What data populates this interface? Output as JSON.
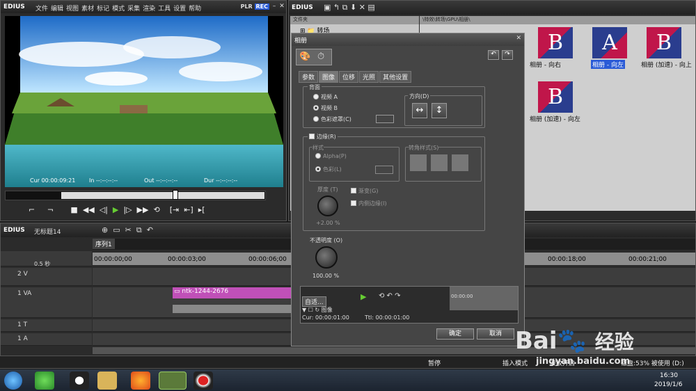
{
  "player": {
    "logo": "EDIUS",
    "menu": [
      "文件",
      "编辑",
      "视图",
      "素材",
      "标记",
      "模式",
      "采集",
      "渲染",
      "工具",
      "设置",
      "帮助"
    ],
    "plr": "PLR",
    "rec": "REC",
    "cur_label": "Cur",
    "cur": "00:00:09:21",
    "in_label": "In",
    "in": "--:--:--:--",
    "out_label": "Out",
    "out": "--:--:--:--",
    "dur_label": "Dur",
    "dur": "--:--:--:--"
  },
  "bin": {
    "logo": "EDIUS",
    "tree_header": "文件夹",
    "tree_item": "转场",
    "path": "\\特效\\转场\\GPU\\相册\\",
    "thumbs": [
      {
        "letter": "B",
        "label": "相册 - 向右"
      },
      {
        "letter": "A",
        "label": "相册 - 向左"
      },
      {
        "letter": "B",
        "label": "相册 (加速) - 向上"
      },
      {
        "letter": "B",
        "label": "相册 (加速) - 向左"
      }
    ]
  },
  "timeline": {
    "logo": "EDIUS",
    "project": "无标题14",
    "sequence": "序列1",
    "zoom": "0.5 秒",
    "ruler": [
      "00:00:00;00",
      "00:00:03;00",
      "00:00:06;00",
      "00:00:18;00",
      "00:00:21;00"
    ],
    "tracks": [
      {
        "name": "2 V"
      },
      {
        "name": "1 VA"
      },
      {
        "name": "1 T"
      },
      {
        "name": "1 A"
      }
    ],
    "clip": "ntk-1244-2676"
  },
  "status": {
    "mode1": "暂停",
    "mode2": "插入模式",
    "mode3": "波纹开启",
    "disk": "磁盘:53% 被使用 (D:)"
  },
  "taskbar": {
    "time": "16:30",
    "date": "2019/1/6"
  },
  "dialog": {
    "title": "相册",
    "tabs": [
      "参数",
      "图像",
      "位移",
      "光照",
      "其他设置"
    ],
    "bg_group": "背面",
    "radio_a": "视频 A",
    "radio_b": "视频 B",
    "radio_mask": "色彩遮罩(C)",
    "direction_group": "方向(D)",
    "border_check": "边缘(R)",
    "style_group": "样式",
    "alpha": "Alpha(P)",
    "color": "色彩(L)",
    "corner_group": "转角样式(S)",
    "thickness": "厚度 (T)",
    "thickness_val": "+2.00 %",
    "gradient": "渐变(G)",
    "inner": "内侧边缘(I)",
    "opacity": "不透明度 (O)",
    "opacity_val": "100.00 %",
    "mini_select": "自适...",
    "mini_track": "图像",
    "mini_cur": "Cur: 00:00:01:00",
    "mini_ttl": "Ttl: 00:00:01:00",
    "mini_tc": "00:00:00",
    "ok": "确定",
    "cancel": "取消"
  },
  "watermark": {
    "brand": "Bai",
    "brand2": "经验",
    "url": "jingyan.baidu.com"
  }
}
